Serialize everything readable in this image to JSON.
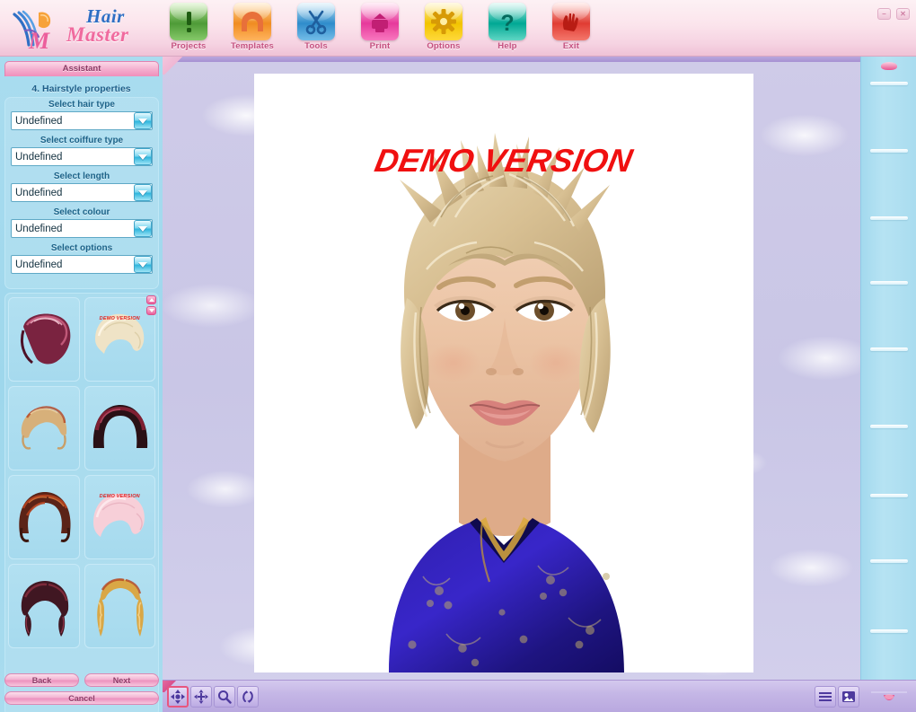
{
  "app": {
    "brand_line1": "Hair",
    "brand_line2": "Master",
    "accent_pink": "#ef8fbb",
    "accent_blue": "#a9dcef",
    "watermark": "DEMO VERSION"
  },
  "window_controls": [
    {
      "name": "minimize-button",
      "glyph": "–"
    },
    {
      "name": "close-button",
      "glyph": "✕"
    }
  ],
  "toolbar": {
    "items": [
      {
        "label": "Projects",
        "icon": "exclamation-icon",
        "color": "#4e9b37"
      },
      {
        "label": "Templates",
        "icon": "template-arch-icon",
        "color": "#f08c22"
      },
      {
        "label": "Tools",
        "icon": "scissors-icon",
        "color": "#2f8ccb"
      },
      {
        "label": "Print",
        "icon": "printer-icon",
        "color": "#e6399b"
      },
      {
        "label": "Options",
        "icon": "gear-icon",
        "color": "#f2c300"
      },
      {
        "label": "Help",
        "icon": "question-mark-icon",
        "color": "#00a894"
      },
      {
        "label": "Exit",
        "icon": "exit-hand-icon",
        "color": "#e03c33"
      }
    ]
  },
  "sidebar": {
    "tab_label": "Assistant",
    "step_title": "4. Hairstyle properties",
    "fields": [
      {
        "label": "Select hair type",
        "value": "Undefined",
        "placeholder": "Undefined"
      },
      {
        "label": "Select coiffure type",
        "value": "Undefined",
        "placeholder": "Undefined"
      },
      {
        "label": "Select length",
        "value": "Undefined",
        "placeholder": "Undefined"
      },
      {
        "label": "Select colour",
        "value": "Undefined",
        "placeholder": "Undefined"
      },
      {
        "label": "Select options",
        "value": "Undefined",
        "placeholder": "Undefined"
      }
    ],
    "thumbnails": [
      {
        "name": "hairstyle-thumb-1",
        "style": "bob-sleek",
        "color": "#7a2340",
        "color2": "#c05878",
        "demo": false
      },
      {
        "name": "hairstyle-thumb-2",
        "style": "short-blonde",
        "color": "#efe3c6",
        "color2": "#fdf6e6",
        "demo": true
      },
      {
        "name": "hairstyle-thumb-3",
        "style": "short-spiky",
        "color": "#d7b07a",
        "color2": "#e8c999",
        "demo": false
      },
      {
        "name": "hairstyle-thumb-4",
        "style": "bowl-dark",
        "color": "#2a1116",
        "color2": "#8e2338",
        "demo": false
      },
      {
        "name": "hairstyle-thumb-5",
        "style": "curly-auburn",
        "color": "#5b2317",
        "color2": "#b5431f",
        "demo": false
      },
      {
        "name": "hairstyle-thumb-6",
        "style": "wavy-pastel",
        "color": "#f7cfd8",
        "color2": "#fde8ec",
        "demo": true
      },
      {
        "name": "hairstyle-thumb-7",
        "style": "braided-dark",
        "color": "#401722",
        "color2": "#7d2a3a",
        "demo": false
      },
      {
        "name": "hairstyle-thumb-8",
        "style": "long-curls-blonde",
        "color": "#d9a746",
        "color2": "#f2cf86",
        "demo": false
      }
    ],
    "thumb_demo_tag": "DEMO VERSION",
    "scroll_up": "▲",
    "scroll_down": "▼",
    "buttons": {
      "back": "Back",
      "next": "Next",
      "cancel": "Cancel"
    }
  },
  "bottom_bar": {
    "tools": [
      {
        "name": "pan-tool",
        "icon": "four-arrows-move-icon",
        "selected": true
      },
      {
        "name": "move-tool",
        "icon": "move-cross-icon",
        "selected": false
      },
      {
        "name": "zoom-tool",
        "icon": "magnifier-icon",
        "selected": false
      },
      {
        "name": "rotate-tool",
        "icon": "rotate-arrows-icon",
        "selected": false
      }
    ],
    "right_tools": [
      {
        "name": "list-view-button",
        "icon": "list-lines-icon"
      },
      {
        "name": "photo-view-button",
        "icon": "photo-image-icon"
      }
    ]
  },
  "right_panel": {
    "separator_count": 9,
    "badge_top": "scroll-handle-top",
    "badge_bottom": "scroll-handle-bottom"
  },
  "photo": {
    "subject": "woman-short-blonde-hair-blue-silk-top",
    "background": "#ffffff"
  }
}
